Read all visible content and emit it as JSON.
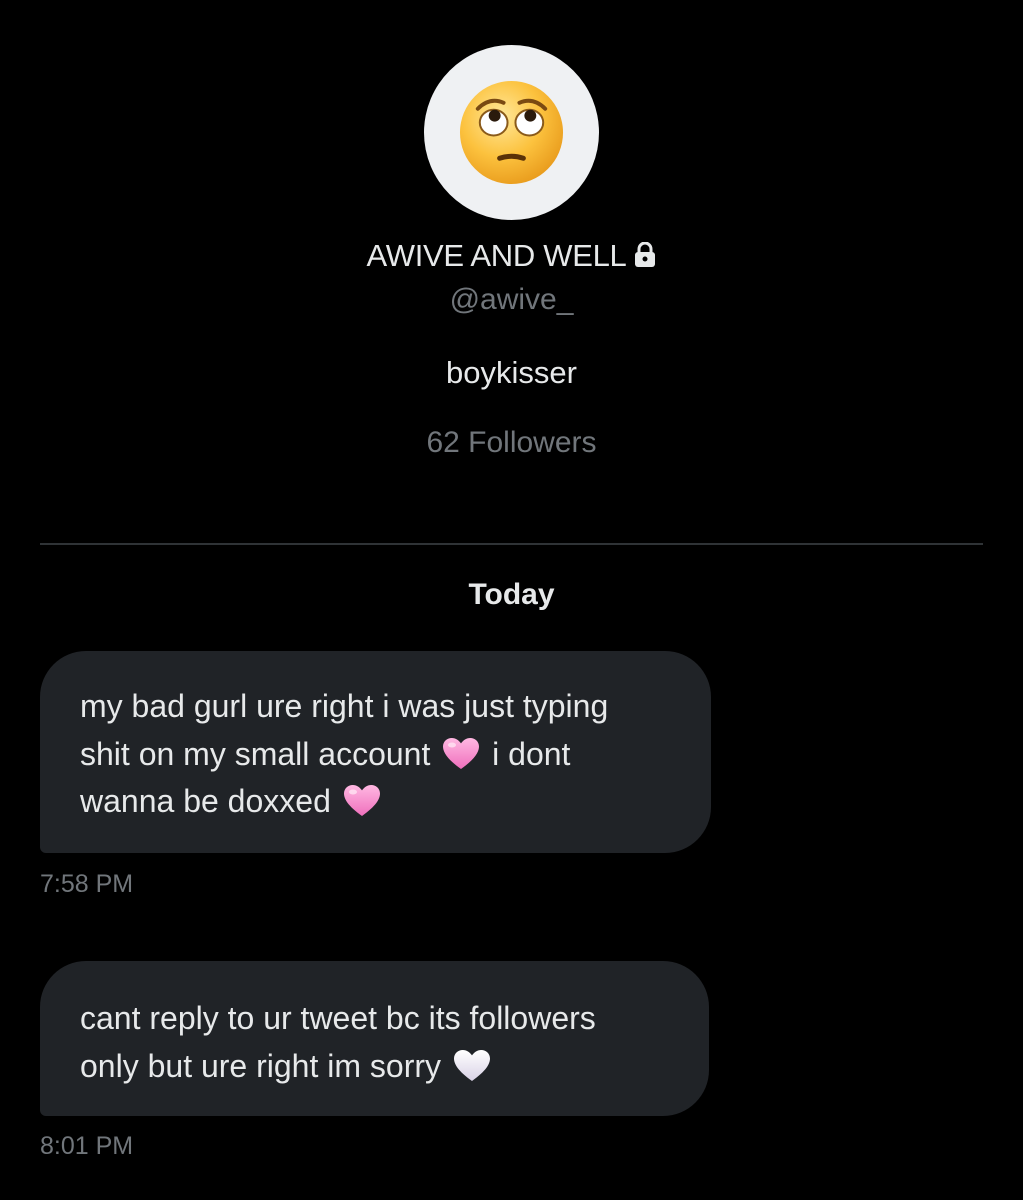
{
  "profile": {
    "avatar_icon": "eye-roll-face-icon",
    "display_name": "AWIVE AND WELL",
    "lock_icon": "lock-icon",
    "handle": "@awive_",
    "bio": "boykisser",
    "followers": "62 Followers"
  },
  "conversation": {
    "date_separator": "Today",
    "messages": [
      {
        "lines": [
          "my bad gurl ure right i was just typing",
          "shit on my small account",
          "i dont",
          "wanna be doxxed"
        ],
        "emojis": [
          "pink-heart-icon",
          "pink-heart-icon"
        ],
        "time": "7:58 PM"
      },
      {
        "lines": [
          "cant reply to ur tweet bc its followers",
          "only but ure right im sorry"
        ],
        "emojis": [
          "white-heart-icon"
        ],
        "time": "8:01 PM"
      }
    ]
  },
  "colors": {
    "background": "#000000",
    "bubble": "#202327",
    "primary_text": "#e7e9ea",
    "secondary_text": "#71767b",
    "divider": "#2f3336",
    "pink_heart": "#f78fce",
    "white_heart": "#f1eef6"
  }
}
